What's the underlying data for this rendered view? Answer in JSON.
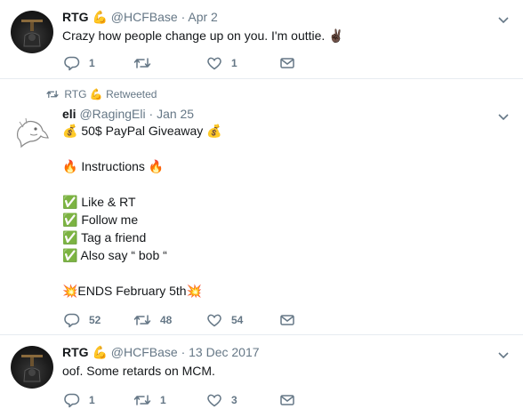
{
  "tweets": [
    {
      "name": "RTG",
      "name_emoji": "💪",
      "handle": "@HCFBase",
      "date": "Apr 2",
      "lines": [
        "Crazy how people change up on you. I'm outtie. ✌🏿"
      ],
      "replies": "1",
      "retweets": "",
      "likes": "1"
    },
    {
      "retweeted_by": "RTG",
      "retweeted_emoji": "💪",
      "retweeted_label": "Retweeted",
      "name": "eli",
      "handle": "@RagingEli",
      "date": "Jan 25",
      "lines": [
        "💰 50$ PayPal Giveaway 💰",
        "",
        "🔥 Instructions 🔥",
        "",
        "✅ Like & RT",
        "✅ Follow me",
        "✅ Tag a friend",
        "✅ Also say “ bob “",
        "",
        "💥ENDS February 5th💥"
      ],
      "replies": "52",
      "retweets": "48",
      "likes": "54"
    },
    {
      "name": "RTG",
      "name_emoji": "💪",
      "handle": "@HCFBase",
      "date": "13 Dec 2017",
      "lines": [
        "oof. Some retards on MCM."
      ],
      "replies": "1",
      "retweets": "1",
      "likes": "3"
    }
  ],
  "separator": "·",
  "icons": [
    "reply-icon",
    "retweet-icon",
    "like-icon",
    "dm-icon",
    "chevron-down-icon"
  ],
  "colors": {
    "secondary_text": "#657786",
    "primary_text": "#14171a",
    "border": "#e6ecf0"
  }
}
